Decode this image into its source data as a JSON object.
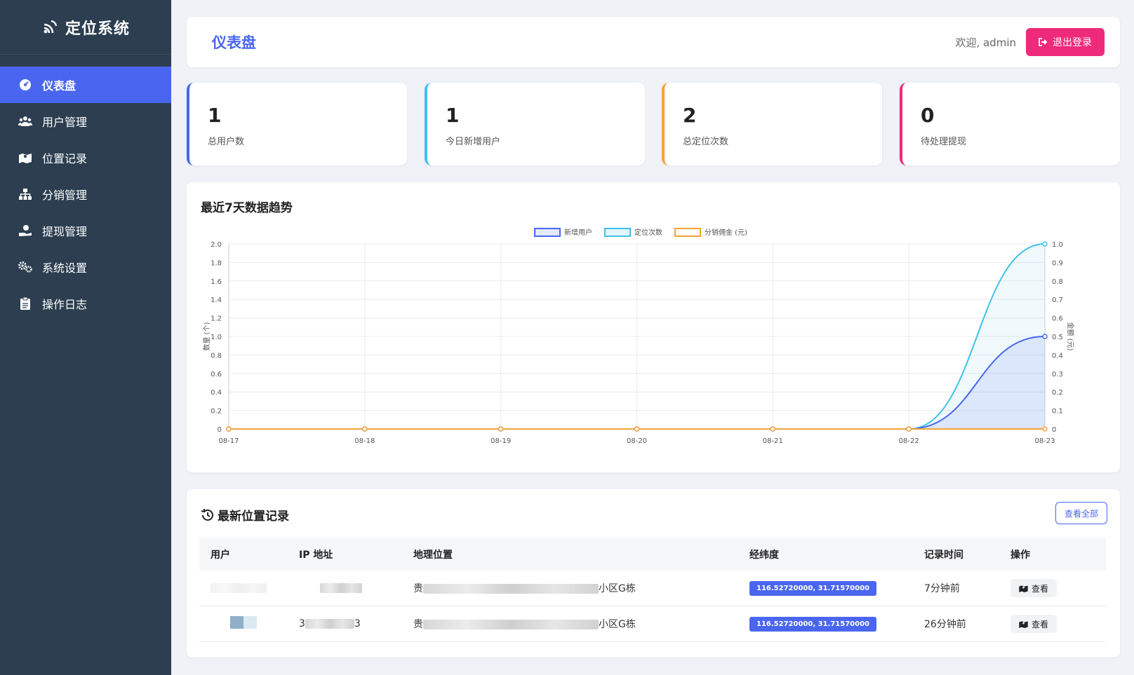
{
  "app": {
    "brand": "定位系统"
  },
  "sidebar": {
    "items": [
      {
        "label": "仪表盘",
        "icon": "dashboard-icon",
        "active": true
      },
      {
        "label": "用户管理",
        "icon": "users-icon"
      },
      {
        "label": "位置记录",
        "icon": "map-icon"
      },
      {
        "label": "分销管理",
        "icon": "sitemap-icon"
      },
      {
        "label": "提现管理",
        "icon": "hand-coin-icon"
      },
      {
        "label": "系统设置",
        "icon": "gears-icon"
      },
      {
        "label": "操作日志",
        "icon": "clipboard-icon"
      }
    ]
  },
  "header": {
    "title": "仪表盘",
    "welcome": "欢迎, admin",
    "logout_label": "退出登录"
  },
  "stats": [
    {
      "value": "1",
      "label": "总用户数",
      "color": "#4a66f0"
    },
    {
      "value": "1",
      "label": "今日新增用户",
      "color": "#3fc3e8"
    },
    {
      "value": "2",
      "label": "总定位次数",
      "color": "#f7a23b"
    },
    {
      "value": "0",
      "label": "待处理提现",
      "color": "#ee2a7b"
    }
  ],
  "chart_section": {
    "title": "最近7天数据趋势"
  },
  "chart_data": {
    "type": "line",
    "categories": [
      "08-17",
      "08-18",
      "08-19",
      "08-20",
      "08-21",
      "08-22",
      "08-23"
    ],
    "series": [
      {
        "name": "新增用户",
        "values": [
          0,
          0,
          0,
          0,
          0,
          0,
          1
        ],
        "axis": "left",
        "color": "#4a66f0",
        "fill": true
      },
      {
        "name": "定位次数",
        "values": [
          0,
          0,
          0,
          0,
          0,
          0,
          2
        ],
        "axis": "left",
        "color": "#3fc3e8",
        "fill": true
      },
      {
        "name": "分销佣金 (元)",
        "values": [
          0,
          0,
          0,
          0,
          0,
          0,
          0
        ],
        "axis": "right",
        "color": "#f7a23b",
        "fill": false
      }
    ],
    "ylabel": "数量 (个)",
    "y2label": "金额 (元)",
    "ylim": [
      0,
      2.0
    ],
    "y2lim": [
      0,
      1.0
    ],
    "yticks": [
      "0",
      "0.2",
      "0.4",
      "0.6",
      "0.8",
      "1.0",
      "1.2",
      "1.4",
      "1.6",
      "1.8",
      "2.0"
    ],
    "y2ticks": [
      "0",
      "0.1",
      "0.2",
      "0.3",
      "0.4",
      "0.5",
      "0.6",
      "0.7",
      "0.8",
      "0.9",
      "1.0"
    ],
    "legend": "top-center",
    "grid": true
  },
  "records": {
    "title": "最新位置记录",
    "view_all_label": "查看全部",
    "columns": [
      "用户",
      "IP 地址",
      "地理位置",
      "经纬度",
      "记录时间",
      "操作"
    ],
    "rows": [
      {
        "user": "",
        "ip": "",
        "location_prefix": "贵",
        "location_suffix": "小区G栋",
        "coords": "116.52720000, 31.71570000",
        "time": "7分钟前",
        "action": "查看"
      },
      {
        "user": "",
        "ip_prefix": "3",
        "ip_suffix": "3",
        "location_prefix": "贵",
        "location_suffix": "小区G栋",
        "coords": "116.52720000, 31.71570000",
        "time": "26分钟前",
        "action": "查看"
      }
    ]
  }
}
